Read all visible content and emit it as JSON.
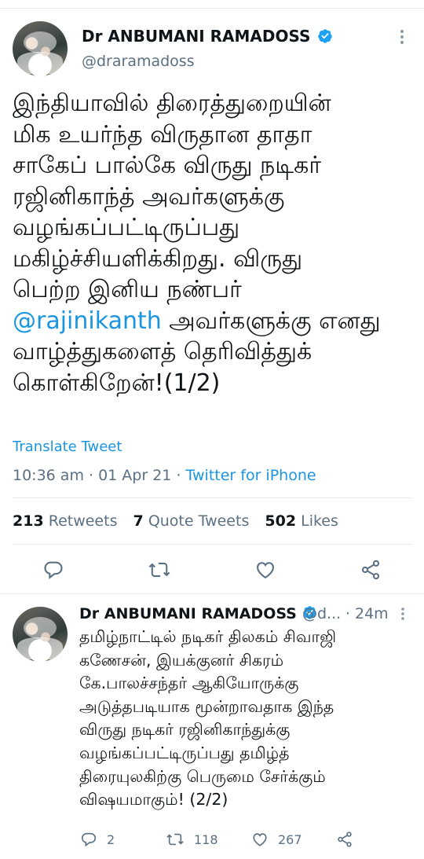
{
  "main_tweet": {
    "author_name": "Dr ANBUMANI RAMADOSS",
    "author_handle": "@draramadoss",
    "text_lines": [
      "இந்தியாவில் திரைத்துறையின்",
      "மிக உயர்ந்த விருதான தாதா",
      "சாகேப் பால்கே விருது நடிகர்",
      "ரஜினிகாந்த் அவர்களுக்கு",
      "வழங்கப்பட்டிருப்பது",
      "மகிழ்ச்சியளிக்கிறது. விருது",
      "பெற்ற இனிய நண்பர்"
    ],
    "mention": "@rajinikanth",
    "mention_line_rest": " அவர்களுக்கு எனது",
    "text_lines_after": [
      "வாழ்த்துகளைத் தெரிவித்துக்",
      "கொள்கிறேன்!(1/2)"
    ],
    "translate_label": "Translate Tweet",
    "time": "10:36 am",
    "date": "01 Apr 21",
    "source": "Twitter for iPhone",
    "stats": {
      "retweets_count": "213",
      "retweets_label": "Retweets",
      "quote_count": "7",
      "quote_label": "Quote Tweets",
      "likes_count": "502",
      "likes_label": "Likes"
    }
  },
  "reply_tweet": {
    "author_name": "Dr ANBUMANI RAMADOSS",
    "author_handle": "@d...",
    "age": "24m",
    "text_lines": [
      "தமிழ்நாட்டில் நடிகர் திலகம் சிவாஜி",
      "கணேசன், இயக்குனர் சிகரம்",
      "கே.பாலச்சந்தர் ஆகியோருக்கு",
      "அடுத்தபடியாக மூன்றாவதாக இந்த",
      "விருது நடிகர் ரஜினிகாந்துக்கு",
      "வழங்கப்பட்டிருப்பது தமிழ்த்",
      "திரையுலகிற்கு பெருமை சேர்க்கும்",
      "விஷயமாகும்! (2/2)"
    ],
    "reply_count": "2",
    "retweet_count": "118",
    "like_count": "267"
  },
  "colors": {
    "accent": "#1b95e0",
    "muted": "#5b7083",
    "text": "#0f1419",
    "divider": "#e6ecf0"
  },
  "icons": {
    "reply": "reply-icon",
    "retweet": "retweet-icon",
    "like": "heart-icon",
    "share": "share-icon",
    "verified": "verified-badge-icon",
    "more": "more-icon"
  }
}
